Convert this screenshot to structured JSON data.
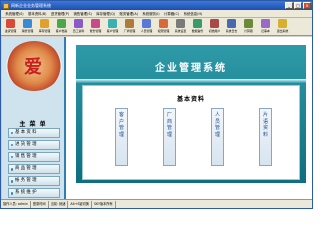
{
  "window": {
    "title": "网新企业业务管理系统",
    "minimize_label": "_",
    "maximize_label": "□",
    "close_label": "×"
  },
  "menubar": {
    "items": [
      {
        "label": "系统管理(S)"
      },
      {
        "label": "基本资料(B)"
      },
      {
        "label": "进货管理(P)"
      },
      {
        "label": "销售管理(S)"
      },
      {
        "label": "库存管理(Q)"
      },
      {
        "label": "账务管理(A)"
      },
      {
        "label": "系统服务(I)"
      },
      {
        "label": "计算器(C)"
      },
      {
        "label": "系统信息(H)"
      }
    ]
  },
  "toolbar": {
    "items": [
      {
        "label": "进货管理",
        "icon": "purchase-icon",
        "color": "#d84a3a"
      },
      {
        "label": "销售管理",
        "icon": "sales-icon",
        "color": "#3a8ad8"
      },
      {
        "label": "库存管理",
        "icon": "inventory-icon",
        "color": "#e0a030"
      },
      {
        "label": "客户档案",
        "icon": "customer-icon",
        "color": "#4aa84a"
      },
      {
        "label": "员工资料",
        "icon": "staff-icon",
        "color": "#8a5ac8"
      },
      {
        "label": "账务管理",
        "icon": "accounting-icon",
        "color": "#c84a8a"
      },
      {
        "label": "客户管理",
        "icon": "client-icon",
        "color": "#3ab0b0"
      },
      {
        "label": "厂商管理",
        "icon": "vendor-icon",
        "color": "#b07a3a"
      },
      {
        "label": "人员管理",
        "icon": "people-icon",
        "color": "#5a7ad8"
      },
      {
        "label": "权限管理",
        "icon": "permission-icon",
        "color": "#d86a3a"
      },
      {
        "label": "系统设置",
        "icon": "settings-icon",
        "color": "#7a7a7a"
      },
      {
        "label": "数据备份",
        "icon": "backup-icon",
        "color": "#3a9a6a"
      },
      {
        "label": "初始用户",
        "icon": "user-icon",
        "color": "#a84a4a"
      },
      {
        "label": "系统日志",
        "icon": "log-icon",
        "color": "#4a6ab0"
      },
      {
        "label": "计算器",
        "icon": "calculator-icon",
        "color": "#6a8a3a"
      },
      {
        "label": "记事本",
        "icon": "notepad-icon",
        "color": "#9a6ac8"
      },
      {
        "label": "退出系统",
        "icon": "exit-icon",
        "color": "#d8b030"
      }
    ]
  },
  "logo": {
    "char": "爱"
  },
  "sidebar": {
    "title": "主 菜 单",
    "items": [
      {
        "label": "基本资料"
      },
      {
        "label": "进货管理"
      },
      {
        "label": "销售管理"
      },
      {
        "label": "商品管理"
      },
      {
        "label": "帐务管理"
      },
      {
        "label": "系统维护"
      }
    ]
  },
  "banner": {
    "title": "企业管理系统",
    "section_title": "基本资料",
    "cards": [
      {
        "label": "客户管理",
        "chars": [
          "客",
          "户",
          "管",
          "理"
        ]
      },
      {
        "label": "厂商管理",
        "chars": [
          "厂",
          "商",
          "管",
          "理"
        ]
      },
      {
        "label": "人员管理",
        "chars": [
          "人",
          "员",
          "管",
          "理"
        ]
      },
      {
        "label": "片语资料",
        "chars": [
          "片",
          "语",
          "资",
          "料"
        ]
      }
    ]
  },
  "statusbar": {
    "items": [
      {
        "label": "操作人员: admin"
      },
      {
        "label": "登录时间"
      },
      {
        "label": "当前: 就绪"
      },
      {
        "label": "Alt+S键切换"
      },
      {
        "label": "SKY版本所有"
      }
    ]
  }
}
